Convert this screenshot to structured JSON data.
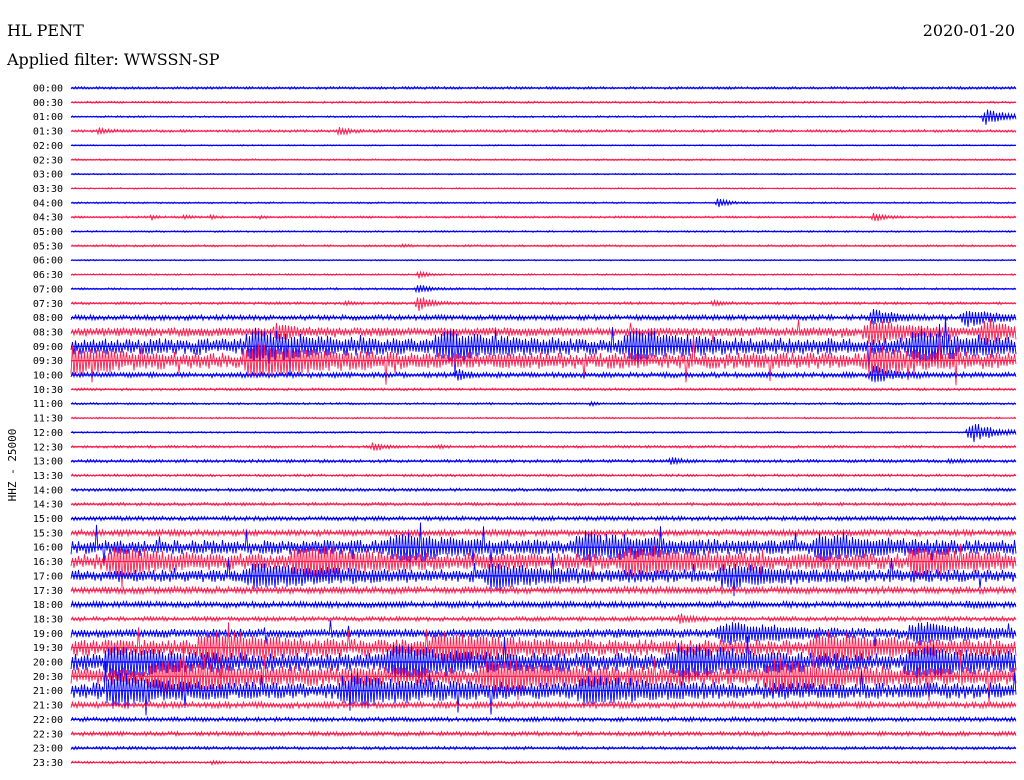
{
  "header": {
    "station": "HL PENT",
    "date": "2020-01-20",
    "filter_label": "Applied filter: WWSSN-SP"
  },
  "chart_data": {
    "type": "line",
    "title": "HL PENT",
    "ylabel": "HHZ - 25000",
    "colors": [
      "#0000ff",
      "#ff1f4f"
    ],
    "traces": [
      {
        "time": "00:00",
        "level": 0.15,
        "bursts": []
      },
      {
        "time": "00:30",
        "level": 0.12,
        "bursts": []
      },
      {
        "time": "01:00",
        "level": 0.1,
        "bursts": [
          [
            0.97,
            1.0,
            0.02
          ]
        ]
      },
      {
        "time": "01:30",
        "level": 0.15,
        "bursts": [
          [
            0.03,
            0.35,
            0.01
          ],
          [
            0.285,
            0.45,
            0.01
          ]
        ]
      },
      {
        "time": "02:00",
        "level": 0.08,
        "bursts": []
      },
      {
        "time": "02:30",
        "level": 0.1,
        "bursts": []
      },
      {
        "time": "03:00",
        "level": 0.08,
        "bursts": []
      },
      {
        "time": "03:30",
        "level": 0.08,
        "bursts": []
      },
      {
        "time": "04:00",
        "level": 0.1,
        "bursts": [
          [
            0.685,
            0.6,
            0.01
          ]
        ]
      },
      {
        "time": "04:30",
        "level": 0.12,
        "bursts": [
          [
            0.085,
            0.25,
            0.005
          ],
          [
            0.12,
            0.25,
            0.005
          ],
          [
            0.148,
            0.25,
            0.005
          ],
          [
            0.2,
            0.2,
            0.004
          ],
          [
            0.85,
            0.55,
            0.01
          ]
        ]
      },
      {
        "time": "05:00",
        "level": 0.1,
        "bursts": []
      },
      {
        "time": "05:30",
        "level": 0.12,
        "bursts": [
          [
            0.35,
            0.2,
            0.006
          ]
        ]
      },
      {
        "time": "06:00",
        "level": 0.08,
        "bursts": []
      },
      {
        "time": "06:30",
        "level": 0.1,
        "bursts": [
          [
            0.368,
            0.4,
            0.008
          ]
        ]
      },
      {
        "time": "07:00",
        "level": 0.12,
        "bursts": [
          [
            0.368,
            0.6,
            0.01
          ]
        ]
      },
      {
        "time": "07:30",
        "level": 0.15,
        "bursts": [
          [
            0.29,
            0.2,
            0.008
          ],
          [
            0.368,
            0.9,
            0.012
          ],
          [
            0.68,
            0.3,
            0.01
          ]
        ]
      },
      {
        "time": "08:00",
        "level": 0.3,
        "bursts": [
          [
            0.85,
            0.9,
            0.02
          ],
          [
            0.95,
            0.8,
            0.03
          ]
        ]
      },
      {
        "time": "08:30",
        "level": 0.5,
        "bursts": [
          [
            0.22,
            0.8,
            0.02
          ],
          [
            0.85,
            1.2,
            0.04
          ],
          [
            0.97,
            1.0,
            0.03
          ]
        ]
      },
      {
        "time": "09:00",
        "level": 0.9,
        "bursts": [
          [
            0.2,
            1.4,
            0.05
          ],
          [
            0.4,
            1.2,
            0.05
          ],
          [
            0.6,
            1.2,
            0.05
          ],
          [
            0.9,
            1.2,
            0.06
          ]
        ]
      },
      {
        "time": "09:30",
        "level": 0.9,
        "bursts": [
          [
            0.0,
            1.4,
            0.04
          ],
          [
            0.2,
            1.6,
            0.06
          ],
          [
            0.85,
            1.2,
            0.04
          ]
        ]
      },
      {
        "time": "10:00",
        "level": 0.3,
        "bursts": [
          [
            0.41,
            0.5,
            0.01
          ],
          [
            0.85,
            0.8,
            0.02
          ]
        ]
      },
      {
        "time": "10:30",
        "level": 0.15,
        "bursts": []
      },
      {
        "time": "11:00",
        "level": 0.12,
        "bursts": [
          [
            0.55,
            0.2,
            0.006
          ]
        ]
      },
      {
        "time": "11:30",
        "level": 0.1,
        "bursts": []
      },
      {
        "time": "12:00",
        "level": 0.1,
        "bursts": [
          [
            0.955,
            1.1,
            0.025
          ]
        ]
      },
      {
        "time": "12:30",
        "level": 0.15,
        "bursts": [
          [
            0.32,
            0.45,
            0.012
          ],
          [
            0.39,
            0.15,
            0.006
          ]
        ]
      },
      {
        "time": "13:00",
        "level": 0.18,
        "bursts": [
          [
            0.635,
            0.55,
            0.008
          ],
          [
            0.93,
            0.2,
            0.01
          ]
        ]
      },
      {
        "time": "13:30",
        "level": 0.15,
        "bursts": []
      },
      {
        "time": "14:00",
        "level": 0.18,
        "bursts": []
      },
      {
        "time": "14:30",
        "level": 0.18,
        "bursts": []
      },
      {
        "time": "15:00",
        "level": 0.25,
        "bursts": []
      },
      {
        "time": "15:30",
        "level": 0.35,
        "bursts": []
      },
      {
        "time": "16:00",
        "level": 0.8,
        "bursts": [
          [
            0.35,
            1.3,
            0.05
          ],
          [
            0.55,
            1.2,
            0.06
          ],
          [
            0.8,
            1.1,
            0.05
          ]
        ]
      },
      {
        "time": "16:30",
        "level": 0.9,
        "bursts": [
          [
            0.05,
            1.2,
            0.04
          ],
          [
            0.25,
            1.4,
            0.06
          ],
          [
            0.6,
            1.2,
            0.06
          ],
          [
            0.9,
            1.2,
            0.05
          ]
        ]
      },
      {
        "time": "17:00",
        "level": 0.7,
        "bursts": [
          [
            0.2,
            1.2,
            0.06
          ],
          [
            0.45,
            1.1,
            0.05
          ],
          [
            0.7,
            1.0,
            0.05
          ]
        ]
      },
      {
        "time": "17:30",
        "level": 0.4,
        "bursts": []
      },
      {
        "time": "18:00",
        "level": 0.35,
        "bursts": [
          [
            0.95,
            0.25,
            0.01
          ]
        ]
      },
      {
        "time": "18:30",
        "level": 0.25,
        "bursts": [
          [
            0.645,
            0.6,
            0.01
          ]
        ]
      },
      {
        "time": "19:00",
        "level": 0.5,
        "bursts": [
          [
            0.7,
            1.0,
            0.06
          ],
          [
            0.9,
            1.0,
            0.05
          ]
        ]
      },
      {
        "time": "19:30",
        "level": 0.9,
        "bursts": [
          [
            0.15,
            1.4,
            0.06
          ],
          [
            0.4,
            1.3,
            0.06
          ],
          [
            0.8,
            1.3,
            0.06
          ]
        ]
      },
      {
        "time": "20:00",
        "level": 1.0,
        "bursts": [
          [
            0.05,
            1.5,
            0.05
          ],
          [
            0.35,
            1.5,
            0.06
          ],
          [
            0.65,
            1.4,
            0.06
          ],
          [
            0.9,
            1.4,
            0.06
          ]
        ]
      },
      {
        "time": "20:30",
        "level": 1.0,
        "bursts": [
          [
            0.1,
            1.5,
            0.06
          ],
          [
            0.45,
            1.5,
            0.06
          ],
          [
            0.75,
            1.4,
            0.06
          ]
        ]
      },
      {
        "time": "21:00",
        "level": 0.9,
        "bursts": [
          [
            0.05,
            1.4,
            0.05
          ],
          [
            0.3,
            1.5,
            0.06
          ],
          [
            0.55,
            1.3,
            0.05
          ]
        ]
      },
      {
        "time": "21:30",
        "level": 0.35,
        "bursts": []
      },
      {
        "time": "22:00",
        "level": 0.25,
        "bursts": []
      },
      {
        "time": "22:30",
        "level": 0.25,
        "bursts": []
      },
      {
        "time": "23:00",
        "level": 0.18,
        "bursts": []
      },
      {
        "time": "23:30",
        "level": 0.15,
        "bursts": [
          [
            0.15,
            0.2,
            0.006
          ]
        ]
      }
    ]
  }
}
